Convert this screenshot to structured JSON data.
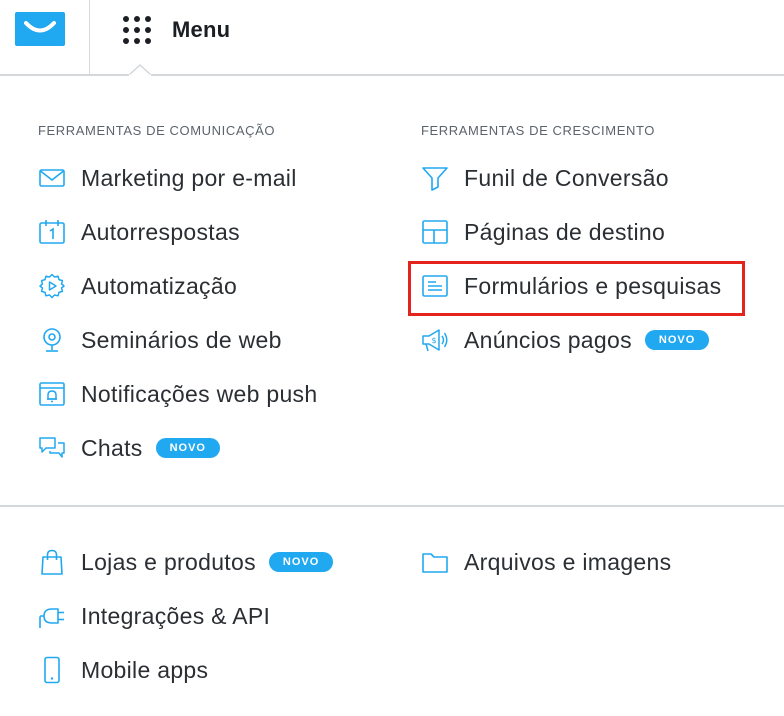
{
  "header": {
    "logo_icon": "envelope-logo-icon",
    "menu_icon": "grid-dots-icon",
    "menu_label": "Menu"
  },
  "colors": {
    "accent": "#20a8f0",
    "highlight": "#e4241c",
    "text": "#2b2f33"
  },
  "communication": {
    "title": "FERRAMENTAS DE COMUNICAÇÃO",
    "items": [
      {
        "label": "Marketing por e-mail",
        "icon": "envelope-icon"
      },
      {
        "label": "Autorrespostas",
        "icon": "calendar-icon"
      },
      {
        "label": "Automatização",
        "icon": "gear-play-icon"
      },
      {
        "label": "Seminários de web",
        "icon": "webcam-icon"
      },
      {
        "label": "Notificações web push",
        "icon": "browser-bell-icon"
      },
      {
        "label": "Chats",
        "icon": "chat-bubbles-icon",
        "badge": "NOVO"
      }
    ]
  },
  "growth": {
    "title": "FERRAMENTAS DE CRESCIMENTO",
    "items": [
      {
        "label": "Funil de Conversão",
        "icon": "funnel-icon"
      },
      {
        "label": "Páginas de destino",
        "icon": "layout-icon"
      },
      {
        "label": "Formulários e pesquisas",
        "icon": "form-icon"
      },
      {
        "label": "Anúncios pagos",
        "icon": "megaphone-icon",
        "badge": "NOVO"
      }
    ]
  },
  "other": {
    "items": [
      {
        "label": "Lojas e produtos",
        "icon": "shopping-bag-icon",
        "badge": "NOVO"
      },
      {
        "label": "Integrações & API",
        "icon": "plug-icon"
      },
      {
        "label": "Mobile apps",
        "icon": "phone-icon"
      },
      {
        "label": "Arquivos e imagens",
        "icon": "folder-icon"
      }
    ]
  }
}
